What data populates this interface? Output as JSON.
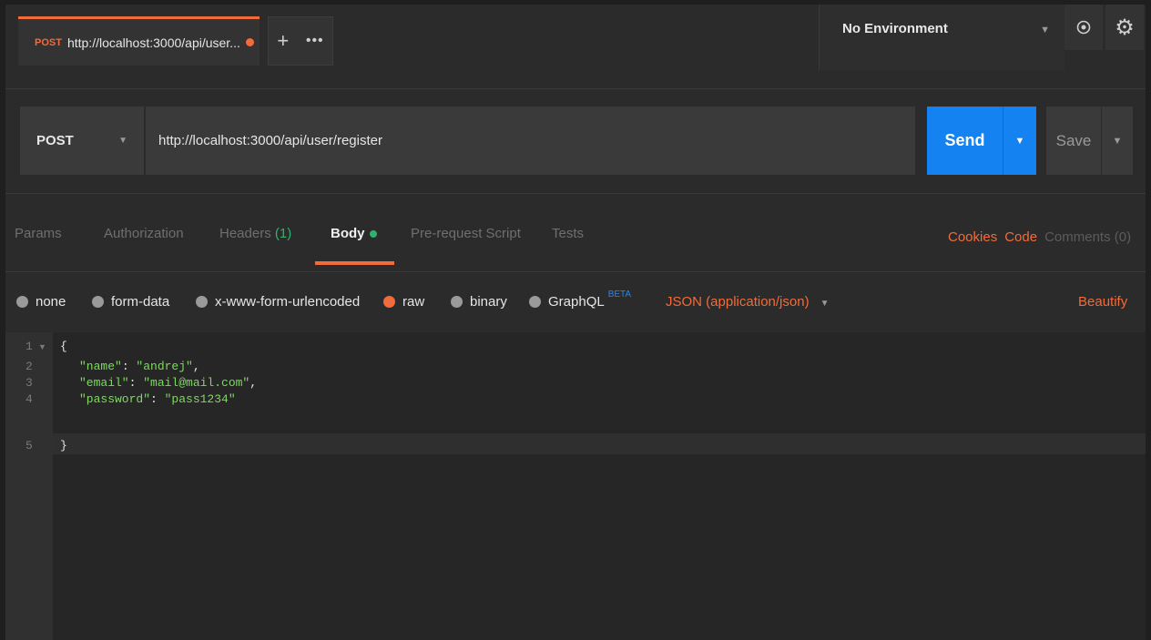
{
  "tab": {
    "method": "POST",
    "title": "http://localhost:3000/api/user...",
    "new_tab": "+",
    "more": "•••"
  },
  "environment": {
    "selected": "No Environment",
    "caret": "▼"
  },
  "icons": {
    "eye": "eye-icon",
    "gear": "gear-icon"
  },
  "request": {
    "method": "POST",
    "method_caret": "▼",
    "url": "http://localhost:3000/api/user/register",
    "send_label": "Send",
    "send_caret": "▼",
    "save_label": "Save",
    "save_caret": "▼"
  },
  "request_tabs": [
    {
      "label": "Params"
    },
    {
      "label": "Authorization"
    },
    {
      "label": "Headers",
      "count": "(1)"
    },
    {
      "label": "Body"
    },
    {
      "label": "Pre-request Script"
    },
    {
      "label": "Tests"
    }
  ],
  "right_links": {
    "cookies": "Cookies",
    "code": "Code",
    "comments": "Comments (0)"
  },
  "body_types": [
    {
      "label": "none",
      "selected": false
    },
    {
      "label": "form-data",
      "selected": false
    },
    {
      "label": "x-www-form-urlencoded",
      "selected": false
    },
    {
      "label": "raw",
      "selected": true
    },
    {
      "label": "binary",
      "selected": false
    },
    {
      "label": "GraphQL",
      "selected": false,
      "badge": "BETA"
    }
  ],
  "content_type": "JSON (application/json)",
  "content_type_caret": "▼",
  "beautify": "Beautify",
  "code": {
    "line_numbers": [
      "1",
      "2",
      "3",
      "4",
      "5"
    ],
    "open_brace": "{",
    "close_brace": "}",
    "fields": [
      {
        "key": "\"name\"",
        "value": "\"andrej\"",
        "trail": ","
      },
      {
        "key": "\"email\"",
        "value": "\"mail@mail.com\"",
        "trail": ","
      },
      {
        "key": "\"password\"",
        "value": "\"pass1234\"",
        "trail": ""
      }
    ]
  },
  "colors": {
    "accent": "#f26b3a",
    "send": "#1482f0",
    "json_key": "#7fd962",
    "tab_badge": "#2fb36b"
  }
}
